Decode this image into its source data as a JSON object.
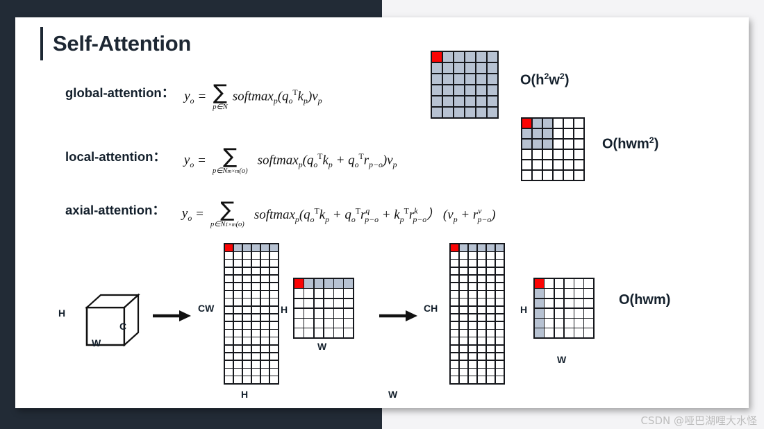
{
  "slide": {
    "title": "Self-Attention",
    "background_dark": "#222b36",
    "background_light": "#f4f4f6",
    "slide_background": "#ffffff"
  },
  "palette": {
    "highlight_red": "#fb0404",
    "attend_blue": "#b7c2d2",
    "grid_line": "#15171c",
    "text_dark": "#14202c"
  },
  "rows": [
    {
      "label": "global-attention：",
      "formula_plain": "y_o = sum_{p in N} softmax_p(q_o^T k_p) v_p",
      "subscript": "p∈N",
      "complexity": "O(h2w2)",
      "complexity_base": "O(h",
      "complexity_sup1": "2",
      "complexity_mid": "w",
      "complexity_sup2": "2",
      "complexity_tail": ")"
    },
    {
      "label": "local-attention：",
      "formula_plain": "y_o = sum_{p in N_{m x m}(o)} softmax_p(q_o^T k_p + q_o^T r_{p-o}) v_p",
      "subscript": "p∈N_{m×m}(o)",
      "complexity": "O(hwm2)"
    },
    {
      "label": "axial-attention：",
      "formula_plain": "y_o = sum_{p in N_{1 x m}(o)} softmax_p(q_o^T k_p + q_o^T r^q_{p-o} + k_p^T r^k_{p-o}) (v_p + r^v_{p-o})",
      "subscript": "p∈N_{1×m}(o)",
      "complexity": "O(hwm)"
    }
  ],
  "grids": {
    "global": {
      "name": "global-attention-grid",
      "cols": 6,
      "rows": 6,
      "pattern": "all-blue-first-red",
      "description": "6 by 6 grid, every cell light blue, top-left cell red"
    },
    "local": {
      "name": "local-attention-grid",
      "cols": 6,
      "rows": 6,
      "pattern": "block-3x3-top-left",
      "description": "6 by 6 grid, top-left 3 by 3 block light blue, top-left cell red"
    },
    "cw_tall": {
      "name": "cw-tall-grid",
      "cols": 6,
      "rows": 18,
      "pattern": "first-row",
      "label_left": "CW",
      "label_bottom": "H"
    },
    "hw_square_1": {
      "name": "hw-square-grid-row",
      "cols": 6,
      "rows": 6,
      "pattern": "first-row",
      "label_left": "H",
      "label_bottom": "W"
    },
    "ch_tall": {
      "name": "ch-tall-grid",
      "cols": 6,
      "rows": 18,
      "pattern": "first-row",
      "label_left": "CH",
      "label_bottom": "W"
    },
    "hw_square_2": {
      "name": "hw-square-grid-column",
      "cols": 6,
      "rows": 6,
      "pattern": "first-column",
      "label_left": "H",
      "label_bottom": "W"
    }
  },
  "cube": {
    "label_h": "H",
    "label_w": "W",
    "label_c": "C"
  },
  "labels": {
    "cw": "CW",
    "ch": "CH",
    "h_left_square1": "H",
    "h_left_square2": "H",
    "h_bottom_tall": "H",
    "w_bottom_tall": "W",
    "w_bottom_square1": "W",
    "w_bottom_square2": "W"
  },
  "complexities": {
    "global_base": "O(h",
    "global_sup1": "2",
    "global_mid": "w",
    "global_sup2": "2",
    "global_tail": ")",
    "local_base": "O(hwm",
    "local_sup": "2",
    "local_tail": ")",
    "axial": "O(hwm)"
  },
  "watermark": "CSDN @哑巴湖哩大水怪"
}
